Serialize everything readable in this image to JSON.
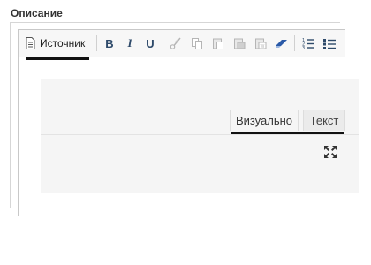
{
  "field": {
    "label": "Описание"
  },
  "toolbar": {
    "source_label": "Источник",
    "items": [
      {
        "name": "bold-icon",
        "glyph": "B"
      },
      {
        "name": "italic-icon",
        "glyph": "I"
      },
      {
        "name": "underline-icon",
        "glyph": "U"
      },
      {
        "name": "cut-icon"
      },
      {
        "name": "copy-icon"
      },
      {
        "name": "paste-icon"
      },
      {
        "name": "paste-text-icon"
      },
      {
        "name": "paste-word-icon"
      },
      {
        "name": "eraser-icon"
      },
      {
        "name": "numbered-list-icon"
      },
      {
        "name": "bulleted-list-icon"
      }
    ]
  },
  "tabs": {
    "visual": "Визуально",
    "text": "Текст",
    "active": "visual"
  },
  "icons": {
    "fullscreen": "fullscreen-icon",
    "source": "document-icon"
  },
  "colors": {
    "eraser": "#2b5aa8",
    "list": "#2e4a6a",
    "disabled": "#b5b5b5"
  }
}
